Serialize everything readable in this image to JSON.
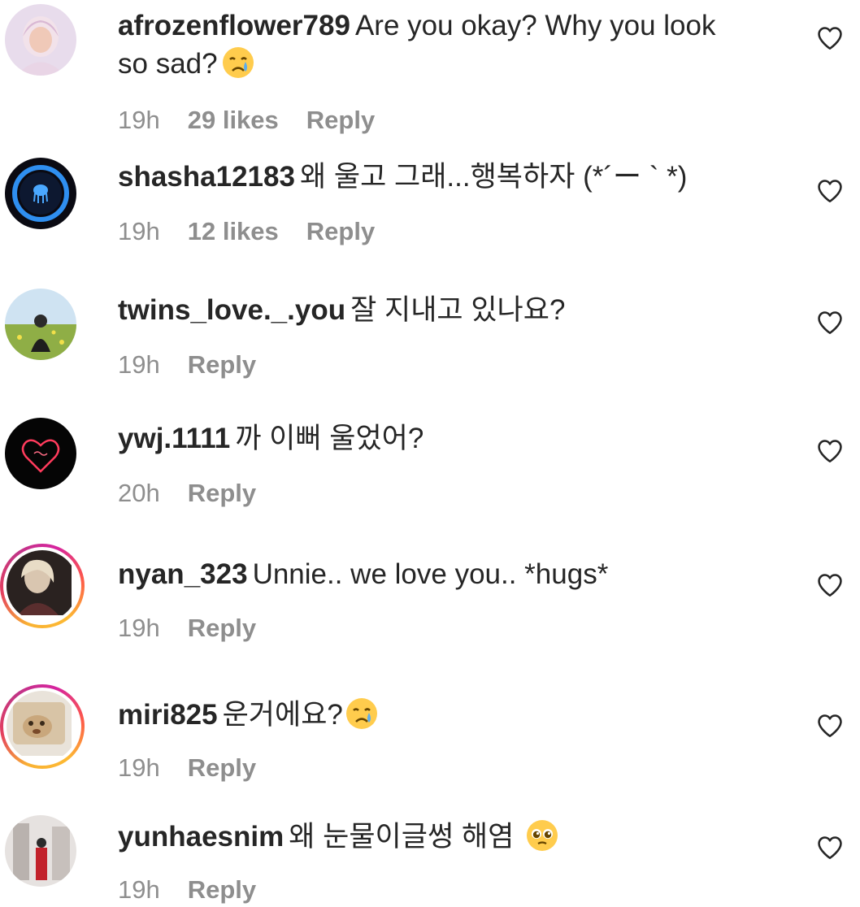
{
  "comments": [
    {
      "username": "afrozenflower789",
      "text": "Are you okay? Why you look so sad?",
      "emoji": "crying-face",
      "time": "19h",
      "likes": "29 likes",
      "reply": "Reply"
    },
    {
      "username": "shasha12183",
      "text": "왜 울고 그래...행복하자 (*´ー ` *)",
      "time": "19h",
      "likes": "12 likes",
      "reply": "Reply"
    },
    {
      "username": "twins_love._.you",
      "text": "잘 지내고 있나요?",
      "time": "19h",
      "reply": "Reply"
    },
    {
      "username": "ywj.1111",
      "text": "까 이뻐 울었어?",
      "time": "20h",
      "reply": "Reply"
    },
    {
      "username": "nyan_323",
      "text": "Unnie.. we love you.. *hugs*",
      "time": "19h",
      "reply": "Reply"
    },
    {
      "username": "miri825",
      "text": "운거에요?",
      "emoji": "crying-face",
      "time": "19h",
      "reply": "Reply"
    },
    {
      "username": "yunhaesnim",
      "text": "왜 눈물이글썽 해염",
      "emoji": "pleading-face",
      "time": "19h",
      "reply": "Reply"
    }
  ],
  "icons": {
    "like": "heart-outline-icon"
  },
  "colors": {
    "text": "#262626",
    "meta": "#8e8e8e"
  }
}
